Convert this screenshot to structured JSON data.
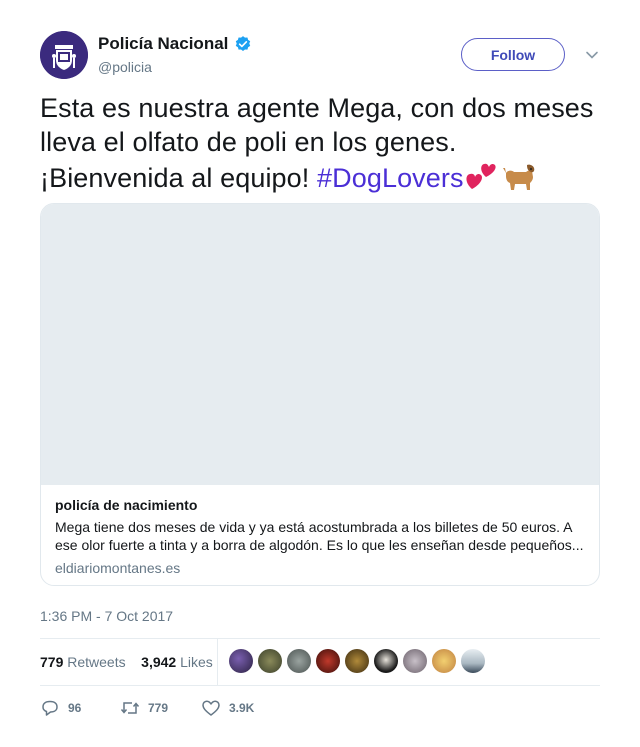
{
  "header": {
    "display_name": "Policía Nacional",
    "handle": "@policia",
    "verified": true,
    "follow_label": "Follow"
  },
  "tweet": {
    "text_before": "Esta es nuestra agente Mega, con dos meses lleva el olfato de poli en los genes. ¡Bienvenida al equipo! ",
    "hashtag": "#DogLovers",
    "emojis": [
      "two-hearts-icon",
      "dog-icon"
    ],
    "hashtag_color": "#4b2fd6"
  },
  "card": {
    "title": "policía de nacimiento",
    "description": "Mega tiene dos meses de vida y ya está acostumbrada a los billetes de 50 euros. A ese olor fuerte a tinta y a borra de algodón. Es lo que les enseñan desde pequeños...",
    "domain": "eldiariomontanes.es"
  },
  "timestamp": "1:36 PM - 7 Oct 2017",
  "stats": {
    "retweets_count": "779",
    "retweets_label": "Retweets",
    "likes_count": "3,942",
    "likes_label": "Likes"
  },
  "actions": {
    "reply_count": "96",
    "retweet_count": "779",
    "like_count": "3.9K"
  },
  "colors": {
    "follow_border": "#5b5fc7",
    "verified": "#1da1f2",
    "avatar_bg": "#3b2a7e"
  }
}
